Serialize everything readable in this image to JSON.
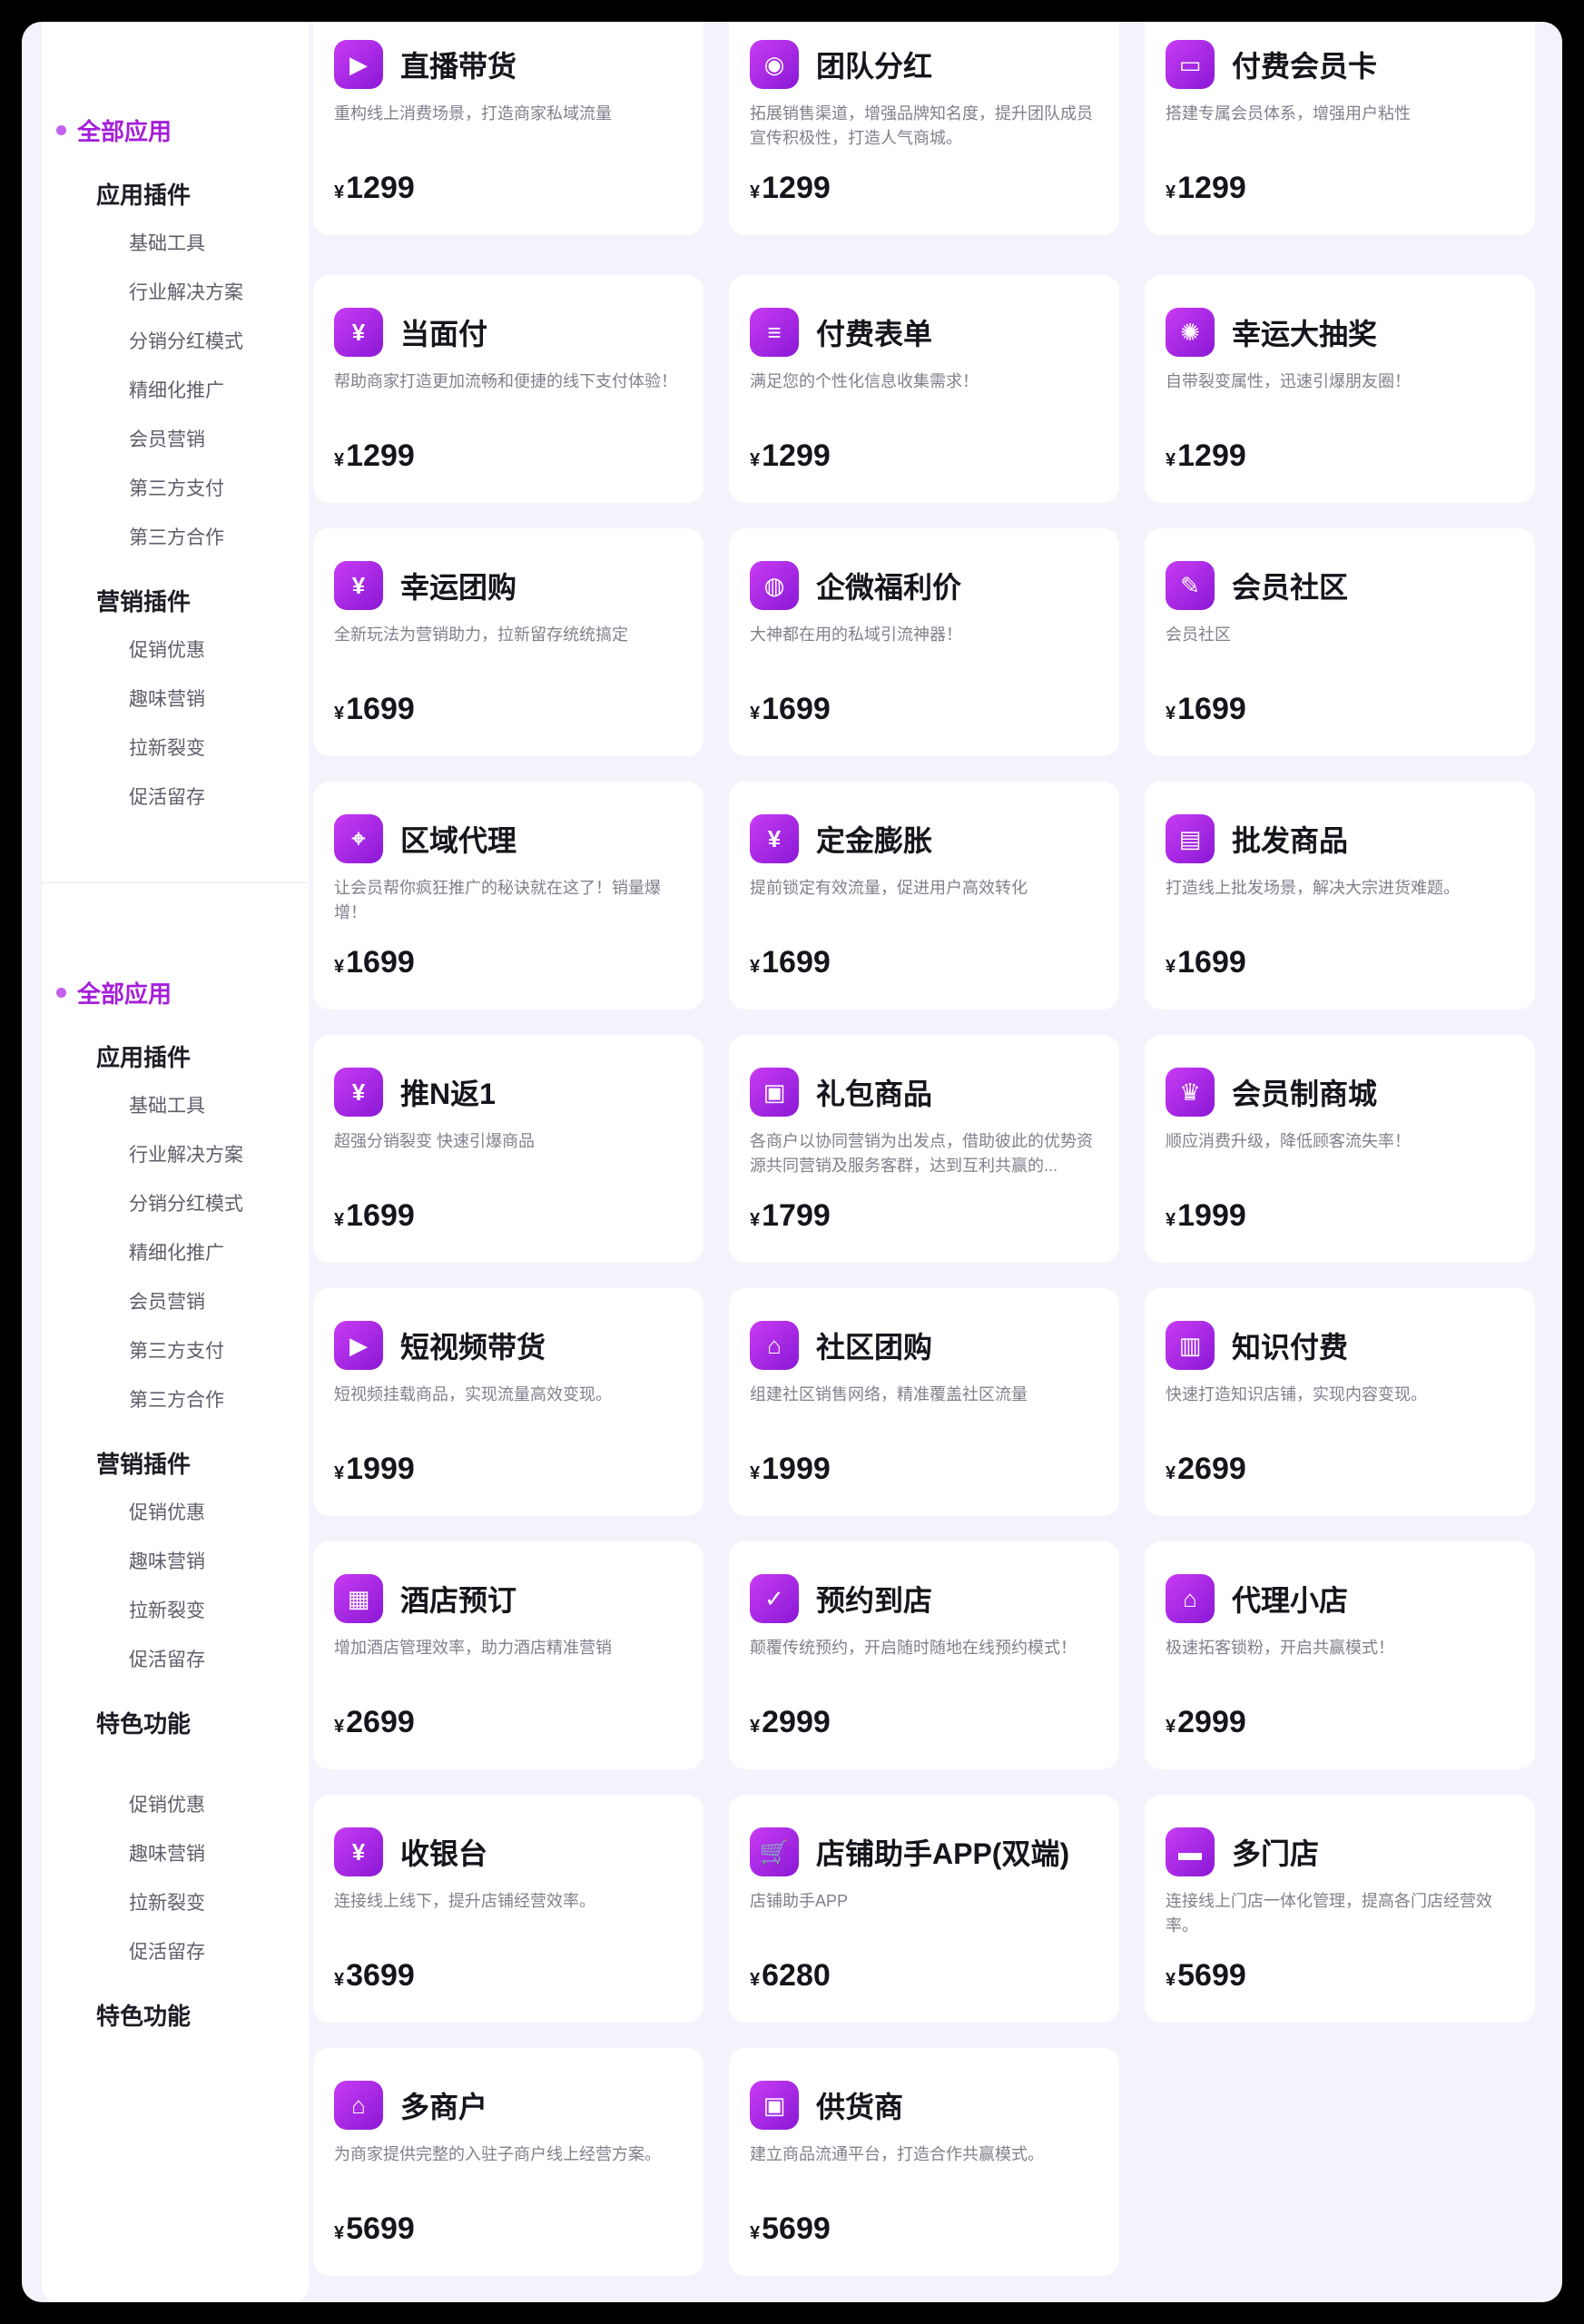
{
  "sidebar": {
    "blocks": [
      {
        "all_label": "全部应用",
        "groups": [
          {
            "title": "应用插件",
            "items": [
              "基础工具",
              "行业解决方案",
              "分销分红模式",
              "精细化推广",
              "会员营销",
              "第三方支付",
              "第三方合作"
            ]
          },
          {
            "title": "营销插件",
            "items": [
              "促销优惠",
              "趣味营销",
              "拉新裂变",
              "促活留存"
            ]
          }
        ]
      },
      {
        "all_label": "全部应用",
        "groups": [
          {
            "title": "应用插件",
            "items": [
              "基础工具",
              "行业解决方案",
              "分销分红模式",
              "精细化推广",
              "会员营销",
              "第三方支付",
              "第三方合作"
            ]
          },
          {
            "title": "营销插件",
            "items": [
              "促销优惠",
              "趣味营销",
              "拉新裂变",
              "促活留存"
            ]
          },
          {
            "title": "特色功能",
            "items": []
          },
          {
            "title": "",
            "items": [
              "促销优惠",
              "趣味营销",
              "拉新裂变",
              "促活留存"
            ]
          },
          {
            "title": "特色功能",
            "items": []
          }
        ]
      }
    ]
  },
  "currency_symbol": "¥",
  "cards": [
    {
      "icon": "live-stream-icon",
      "glyph": "▶",
      "title": "直播带货",
      "desc": "重构线上消费场景，打造商家私域流量",
      "price": "1299"
    },
    {
      "icon": "team-dividend-icon",
      "glyph": "◉",
      "title": "团队分红",
      "desc": "拓展销售渠道，增强品牌知名度，提升团队成员宣传积极性，打造人气商城。",
      "price": "1299"
    },
    {
      "icon": "vip-card-icon",
      "glyph": "▭",
      "title": "付费会员卡",
      "desc": "搭建专属会员体系，增强用户粘性",
      "price": "1299"
    },
    {
      "icon": "face-pay-icon",
      "glyph": "¥",
      "title": "当面付",
      "desc": "帮助商家打造更加流畅和便捷的线下支付体验！",
      "price": "1299"
    },
    {
      "icon": "paid-form-icon",
      "glyph": "≡",
      "title": "付费表单",
      "desc": "满足您的个性化信息收集需求！",
      "price": "1299"
    },
    {
      "icon": "lucky-wheel-icon",
      "glyph": "✺",
      "title": "幸运大抽奖",
      "desc": "自带裂变属性，迅速引爆朋友圈！",
      "price": "1299"
    },
    {
      "icon": "lucky-group-icon",
      "glyph": "¥",
      "title": "幸运团购",
      "desc": "全新玩法为营销助力，拉新留存统统搞定",
      "price": "1699"
    },
    {
      "icon": "wecom-icon",
      "glyph": "◍",
      "title": "企微福利价",
      "desc": "大神都在用的私域引流神器！",
      "price": "1699"
    },
    {
      "icon": "community-edit-icon",
      "glyph": "✎",
      "title": "会员社区",
      "desc": "会员社区",
      "price": "1699"
    },
    {
      "icon": "region-agent-icon",
      "glyph": "⌖",
      "title": "区域代理",
      "desc": "让会员帮你疯狂推广的秘诀就在这了！销量爆增！",
      "price": "1699"
    },
    {
      "icon": "deposit-expand-icon",
      "glyph": "¥",
      "title": "定金膨胀",
      "desc": "提前锁定有效流量，促进用户高效转化",
      "price": "1699"
    },
    {
      "icon": "wholesale-icon",
      "glyph": "▤",
      "title": "批发商品",
      "desc": "打造线上批发场景，解决大宗进货难题。",
      "price": "1699"
    },
    {
      "icon": "push-n-icon",
      "glyph": "¥",
      "title": "推N返1",
      "desc": "超强分销裂变 快速引爆商品",
      "price": "1699"
    },
    {
      "icon": "gift-icon",
      "glyph": "▣",
      "title": "礼包商品",
      "desc": "各商户以协同营销为出发点，借助彼此的优势资源共同营销及服务客群，达到互利共赢的...",
      "price": "1799"
    },
    {
      "icon": "crown-icon",
      "glyph": "♛",
      "title": "会员制商城",
      "desc": "顺应消费升级，降低顾客流失率！",
      "price": "1999"
    },
    {
      "icon": "short-video-icon",
      "glyph": "▶",
      "title": "短视频带货",
      "desc": "短视频挂载商品，实现流量高效变现。",
      "price": "1999"
    },
    {
      "icon": "community-group-icon",
      "glyph": "⌂",
      "title": "社区团购",
      "desc": "组建社区销售网络，精准覆盖社区流量",
      "price": "1999"
    },
    {
      "icon": "knowledge-icon",
      "glyph": "▥",
      "title": "知识付费",
      "desc": "快速打造知识店铺，实现内容变现。",
      "price": "2699"
    },
    {
      "icon": "hotel-icon",
      "glyph": "▦",
      "title": "酒店预订",
      "desc": "增加酒店管理效率，助力酒店精准营销",
      "price": "2699"
    },
    {
      "icon": "calendar-check-icon",
      "glyph": "✓",
      "title": "预约到店",
      "desc": "颠覆传统预约，开启随时随地在线预约模式！",
      "price": "2999"
    },
    {
      "icon": "store-agent-icon",
      "glyph": "⌂",
      "title": "代理小店",
      "desc": "极速拓客锁粉，开启共赢模式！",
      "price": "2999"
    },
    {
      "icon": "cashier-icon",
      "glyph": "¥",
      "title": "收银台",
      "desc": "连接线上线下，提升店铺经营效率。",
      "price": "3699"
    },
    {
      "icon": "shopping-cart-icon",
      "glyph": "🛒",
      "title": "店铺助手APP(双端)",
      "desc": "店铺助手APP",
      "price": "6280"
    },
    {
      "icon": "multi-store-icon",
      "glyph": "▬",
      "title": "多门店",
      "desc": "连接线上门店一体化管理，提高各门店经营效率。",
      "price": "5699"
    },
    {
      "icon": "multi-merchant-icon",
      "glyph": "⌂",
      "title": "多商户",
      "desc": "为商家提供完整的入驻子商户线上经营方案。",
      "price": "5699"
    },
    {
      "icon": "supplier-icon",
      "glyph": "▣",
      "title": "供货商",
      "desc": "建立商品流通平台，打造合作共赢模式。",
      "price": "5699"
    }
  ]
}
